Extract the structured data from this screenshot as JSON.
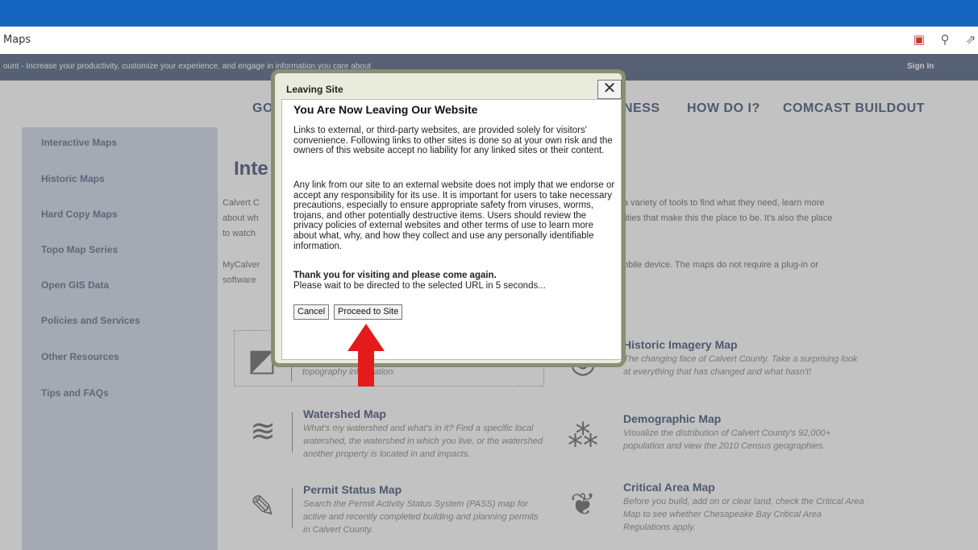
{
  "browser": {
    "tab_text": "Maps",
    "icons": [
      "collections-icon",
      "zoom-icon",
      "share-icon"
    ]
  },
  "banner": {
    "message": "ount - Increase your productivity, customize your experience, and engage in information you care about",
    "sign_in": "Sign In"
  },
  "nav": {
    "items": [
      "GO",
      "NESS",
      "HOW DO I?",
      "COMCAST BUILDOUT"
    ]
  },
  "sidebar": {
    "items": [
      "Interactive Maps",
      "Historic Maps",
      "Hard Copy Maps",
      "Topo Map Series",
      "Open GIS Data",
      "Policies and Services",
      "Other Resources",
      "Tips and FAQs"
    ]
  },
  "main": {
    "title": "Inte",
    "p1_left": "Calvert C",
    "p1_left2": "about wh",
    "p1_left3": "to watch",
    "p1_right": "a variety of tools to find what they need, learn more",
    "p1_right2": "lities that make this the place to be. It's also the place",
    "p2_left": "MyCalver",
    "p2_left2": "software",
    "p2_right": "obile device. The maps do not require a plug-in or",
    "cards": [
      {
        "title": "",
        "desc": "topography information."
      },
      {
        "title": "Historic Imagery Map",
        "desc": "The changing face of Calvert County. Take a surprising look at everything that has changed and what hasn't!"
      },
      {
        "title": "Watershed Map",
        "desc": "What's my watershed and what's in it? Find a specific local watershed, the watershed in which you live, or the watershed another property is located in and impacts."
      },
      {
        "title": "Demographic Map",
        "desc": "Visualize the distribution of Calvert County's 92,000+ population and view the 2010 Census geographies."
      },
      {
        "title": "Permit Status Map",
        "desc": "Search the Permit Activity Status System (PASS) map for active and recently completed building and planning permits in Calvert County."
      },
      {
        "title": "Critical Area Map",
        "desc": "Before you build, add on or clear land, check the Critical Area Map to see whether Chesapeake Bay Critical Area Regulations apply."
      }
    ]
  },
  "dialog": {
    "title": "Leaving Site",
    "close_glyph": "✕",
    "heading": "You Are Now Leaving Our Website",
    "para1": "Links to external, or third-party websites, are provided solely for visitors' convenience. Following links to other sites is done so at your own risk and the owners of this website accept no liability for any linked sites or their content.",
    "para2": "Any link from our site to an external website does not imply that we endorse or accept any responsibility for its use. It is important for users to take necessary precautions, especially to ensure appropriate safety from viruses, worms, trojans, and other potentially destructive items. Users should review the privacy policies of external websites and other terms of use to learn more about what, why, and how they collect and use any personally identifiable information.",
    "thanks": "Thank you for visiting and please come again.",
    "wait": "Please wait to be directed to the selected URL in 5 seconds...",
    "cancel": "Cancel",
    "proceed": "Proceed to Site"
  },
  "colors": {
    "browser_bar": "#1565c0",
    "banner": "#3b4f73",
    "sidebar": "#c9d1e4",
    "arrow": "#e51b1b"
  }
}
